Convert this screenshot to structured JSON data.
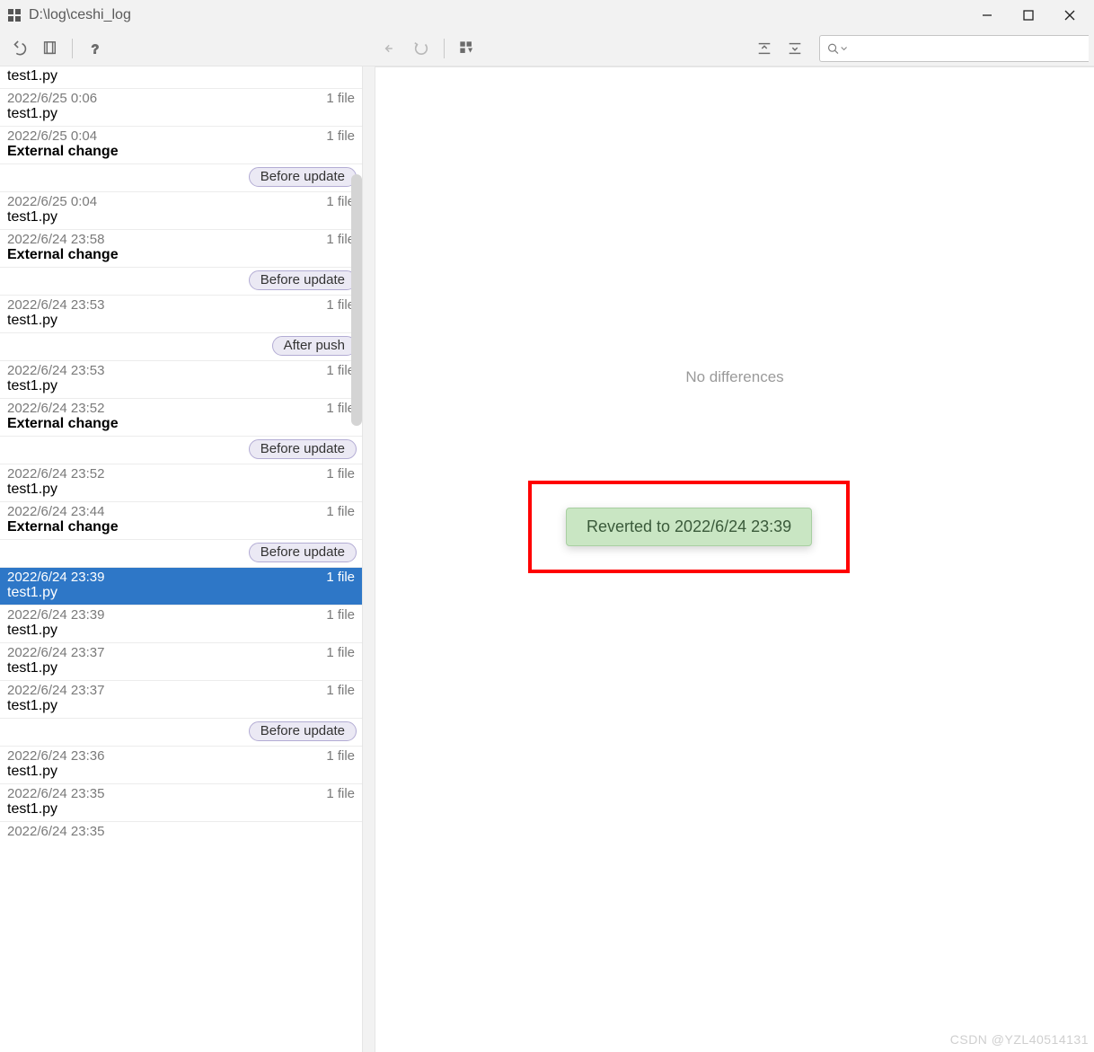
{
  "window": {
    "title": "D:\\log\\ceshi_log"
  },
  "right": {
    "no_diff": "No differences",
    "toast": "Reverted to 2022/6/24 23:39"
  },
  "watermark": "CSDN @YZL40514131",
  "top_fragment": "test1.py",
  "history": [
    {
      "kind": "entry",
      "time": "2022/6/25 0:06",
      "count": "1 file",
      "name": "test1.py"
    },
    {
      "kind": "entry",
      "time": "2022/6/25 0:04",
      "count": "1 file",
      "name": "External change",
      "bold": true
    },
    {
      "kind": "label",
      "text": "Before update"
    },
    {
      "kind": "entry",
      "time": "2022/6/25 0:04",
      "count": "1 file",
      "name": "test1.py"
    },
    {
      "kind": "entry",
      "time": "2022/6/24 23:58",
      "count": "1 file",
      "name": "External change",
      "bold": true
    },
    {
      "kind": "label",
      "text": "Before update"
    },
    {
      "kind": "entry",
      "time": "2022/6/24 23:53",
      "count": "1 file",
      "name": "test1.py"
    },
    {
      "kind": "label",
      "text": "After push"
    },
    {
      "kind": "entry",
      "time": "2022/6/24 23:53",
      "count": "1 file",
      "name": "test1.py"
    },
    {
      "kind": "entry",
      "time": "2022/6/24 23:52",
      "count": "1 file",
      "name": "External change",
      "bold": true
    },
    {
      "kind": "label",
      "text": "Before update"
    },
    {
      "kind": "entry",
      "time": "2022/6/24 23:52",
      "count": "1 file",
      "name": "test1.py"
    },
    {
      "kind": "entry",
      "time": "2022/6/24 23:44",
      "count": "1 file",
      "name": "External change",
      "bold": true
    },
    {
      "kind": "label",
      "text": "Before update"
    },
    {
      "kind": "entry",
      "time": "2022/6/24 23:39",
      "count": "1 file",
      "name": "test1.py",
      "selected": true
    },
    {
      "kind": "entry",
      "time": "2022/6/24 23:39",
      "count": "1 file",
      "name": "test1.py"
    },
    {
      "kind": "entry",
      "time": "2022/6/24 23:37",
      "count": "1 file",
      "name": "test1.py"
    },
    {
      "kind": "entry",
      "time": "2022/6/24 23:37",
      "count": "1 file",
      "name": "test1.py"
    },
    {
      "kind": "label",
      "text": "Before update"
    },
    {
      "kind": "entry",
      "time": "2022/6/24 23:36",
      "count": "1 file",
      "name": "test1.py"
    },
    {
      "kind": "entry",
      "time": "2022/6/24 23:35",
      "count": "1 file",
      "name": "test1.py"
    },
    {
      "kind": "partial",
      "time": "2022/6/24 23:35"
    }
  ]
}
